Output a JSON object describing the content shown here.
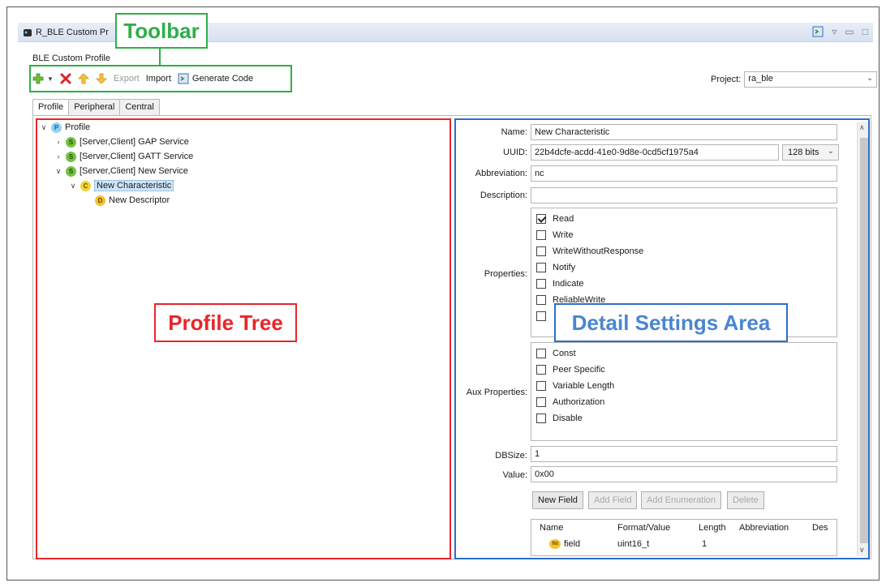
{
  "window": {
    "title": "R_BLE Custom Pr",
    "panel_label": "BLE Custom Profile"
  },
  "toolbar": {
    "add_icon": "green-plus-icon",
    "delete_icon": "red-x-icon",
    "up_icon": "up-arrow-icon",
    "down_icon": "down-arrow-icon",
    "export_label": "Export",
    "import_label": "Import",
    "generate_label": "Generate Code",
    "project_label": "Project:",
    "project_value": "ra_ble"
  },
  "tabs": [
    "Profile",
    "Peripheral",
    "Central"
  ],
  "tree": {
    "root": "Profile",
    "items": [
      "[Server,Client] GAP Service",
      "[Server,Client] GATT Service",
      "[Server,Client] New Service",
      "New Characteristic",
      "New Descriptor"
    ]
  },
  "detail": {
    "name_label": "Name:",
    "name_value": "New Characteristic",
    "uuid_label": "UUID:",
    "uuid_value": "22b4dcfe-acdd-41e0-9d8e-0cd5cf1975a4",
    "uuid_bits": "128 bits",
    "abbrev_label": "Abbreviation:",
    "abbrev_value": "nc",
    "desc_label": "Description:",
    "desc_value": "",
    "properties_label": "Properties:",
    "properties": [
      "Read",
      "Write",
      "WriteWithoutResponse",
      "Notify",
      "Indicate",
      "ReliableWrite"
    ],
    "aux_label": "Aux Properties:",
    "aux_properties": [
      "Const",
      "Peer Specific",
      "Variable Length",
      "Authorization",
      "Disable"
    ],
    "dbsize_label": "DBSize:",
    "dbsize_value": "1",
    "value_label": "Value:",
    "value_value": "0x00",
    "buttons": {
      "new_field": "New Field",
      "add_field": "Add Field",
      "add_enum": "Add Enumeration",
      "delete": "Delete"
    },
    "table": {
      "headers": [
        "Name",
        "Format/Value",
        "Length",
        "Abbreviation",
        "Des"
      ],
      "rows": [
        [
          "field",
          "uint16_t",
          "1",
          "",
          ""
        ]
      ]
    }
  },
  "callouts": {
    "toolbar": "Toolbar",
    "profile_tree": "Profile Tree",
    "detail_area": "Detail Settings Area"
  },
  "colors": {
    "toolbar_annotation": "#2fae4a",
    "tree_annotation": "#e8262a",
    "detail_annotation": "#2d6fc7"
  }
}
